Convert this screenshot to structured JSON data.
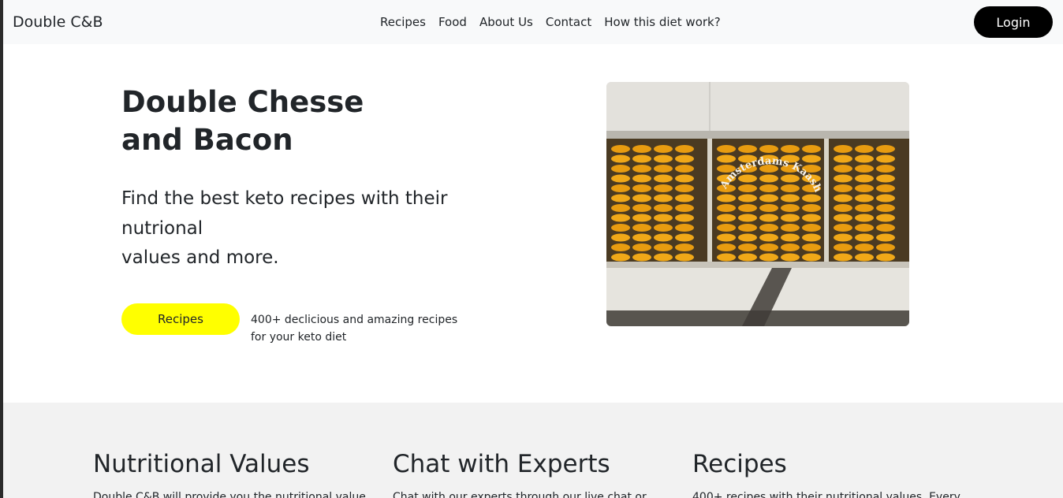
{
  "nav": {
    "brand": "Double C&B",
    "links": [
      "Recipes",
      "Food",
      "About Us",
      "Contact",
      "How this diet work?"
    ],
    "login": "Login"
  },
  "hero": {
    "title_line1": "Double Chesse",
    "title_line2": "and Bacon",
    "subtitle_line1": "Find the best keto recipes with their",
    "subtitle_line2": "nutrional",
    "subtitle_line3": "values and more.",
    "cta_label": "Recipes",
    "cta_note_line1": "400+ declicious and amazing recipes",
    "cta_note_line2": "for your keto diet",
    "image_sign_text": "Amsterdams Kaashuis"
  },
  "features": [
    {
      "title": "Nutritional Values",
      "text": "Double C&B will provide you the nutritional value"
    },
    {
      "title": "Chat with Experts",
      "text": "Chat with our experts through our live chat or"
    },
    {
      "title": "Recipes",
      "text": "400+ recipes with their nutritional values. Every"
    }
  ],
  "colors": {
    "accent": "#ffff00",
    "login_bg": "#000000",
    "navbar_bg": "#f8f9fa",
    "features_bg": "#f2f2f2"
  }
}
